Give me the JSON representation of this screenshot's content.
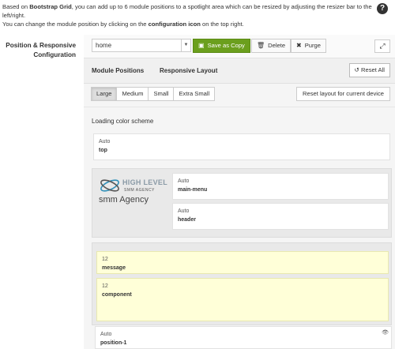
{
  "info": {
    "line1_a": "Based on ",
    "line1_b": "Bootstrap Grid",
    "line1_c": ", you can add up to 6 module positions to a spotlight area which can be resized by adjusting the resizer bar to the left/right.",
    "line2_a": "You can change the module position by clicking on the ",
    "line2_b": "configuration icon",
    "line2_c": " on the top right.",
    "help_icon": "?"
  },
  "label": "Position & Responsive Configuration",
  "toolbar": {
    "select_value": "home",
    "save_copy": "Save as Copy",
    "delete": "Delete",
    "purge": "Purge",
    "expand_icon": "expand-icon"
  },
  "tabs": [
    {
      "label": "Module Positions"
    },
    {
      "label": "Responsive Layout"
    }
  ],
  "reset_all": "Reset All",
  "sizes": [
    "Large",
    "Medium",
    "Small",
    "Extra Small"
  ],
  "active_size": "Large",
  "reset_current": "Reset layout for current device",
  "scheme_label": "Loading color scheme",
  "modules": {
    "top": {
      "width": "Auto",
      "name": "top"
    },
    "main_menu": {
      "width": "Auto",
      "name": "main-menu"
    },
    "header": {
      "width": "Auto",
      "name": "header"
    },
    "message": {
      "width": "12",
      "name": "message"
    },
    "component": {
      "width": "12",
      "name": "component"
    },
    "position1": {
      "width": "Auto",
      "name": "position-1"
    }
  },
  "logo": {
    "brand": "HIGH LEVEL",
    "sub": "SMM AGENCY",
    "big": "smm Agency"
  },
  "colors": {
    "save_button": "#6b9f1d",
    "highlight_module": "#ffffd8"
  }
}
